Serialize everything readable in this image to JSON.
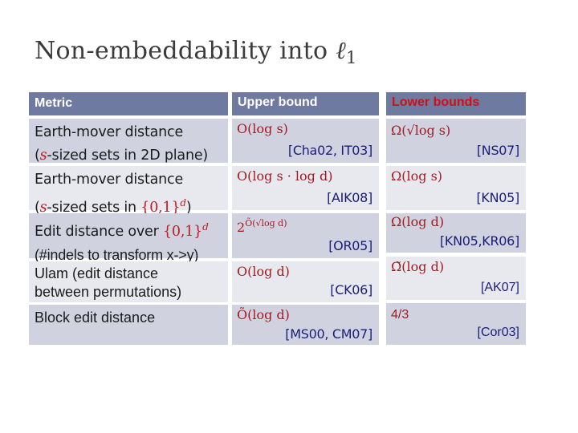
{
  "slide": {
    "title_text": "Non-embeddability into ",
    "title_symbol": "ℓ",
    "title_subscript": "1"
  },
  "table": {
    "headers": {
      "metric": "Metric",
      "upper": "Upper bound",
      "lower": "Lower bounds"
    },
    "colors": {
      "header_bg": "#6f7aa0",
      "row_dark": "#d0d3df",
      "row_light": "#e8e9ee",
      "math_red": "#a11a22",
      "ref_blue": "#1a1d78",
      "lower_header_text": "#d10f17"
    },
    "rows": [
      {
        "metric_line1": "Earth-mover distance",
        "metric_line2_pre": "(",
        "metric_line2_var": "s",
        "metric_line2_post": "-sized sets in 2D plane)",
        "upper_bound": "O(log s)",
        "upper_ref": "[Cha02, IT03]",
        "lower_bound": "Ω(√log s)",
        "lower_ref": "[NS07]"
      },
      {
        "metric_line1": "Earth-mover distance",
        "metric_line2_pre": "(",
        "metric_line2_var": "s",
        "metric_line2_post": "-sized sets in ",
        "metric_line2_math": "{0,1}",
        "metric_line2_sup": "d",
        "metric_line2_end": ")",
        "upper_bound": "O(log s · log d)",
        "upper_ref": "[AIK08]",
        "lower_bound": "Ω(log s)",
        "lower_ref": "[KN05]"
      },
      {
        "metric_line1_pre": "Edit distance over ",
        "metric_line1_math": "{0,1}",
        "metric_line1_sup": "d",
        "metric_line2": "(#indels to transform x->y)",
        "upper_bound_base": "2",
        "upper_bound_exp": "Õ(√log d)",
        "upper_ref": "[OR05]",
        "lower_bound": "Ω(log d)",
        "lower_ref": "[KN05,KR06]"
      },
      {
        "metric_line1": "Ulam (edit distance",
        "metric_line2": "between permutations)",
        "upper_bound": "O(log d)",
        "upper_ref": "[CK06]",
        "lower_bound": "Ω̃(log d)",
        "lower_ref": "[AK07]"
      },
      {
        "metric_line1": "Block edit distance",
        "upper_bound": "Õ(log d)",
        "upper_ref": "[MS00, CM07]",
        "lower_bound": "4/3",
        "lower_ref": "[Cor03]"
      }
    ]
  }
}
